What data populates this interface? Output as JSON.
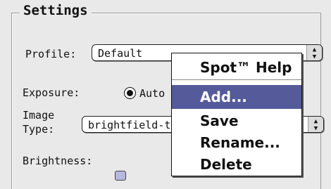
{
  "settings": {
    "title": "Settings",
    "profile_label": "Profile:",
    "profile_value": "Default",
    "exposure_label": "Exposure:",
    "exposure_option": "Auto",
    "image_type_label_line1": "Image",
    "image_type_label_line2": "Type:",
    "image_type_value": "brightfield-tr",
    "brightness_label": "Brightness:"
  },
  "menu": {
    "title_item": "Spot™ Help",
    "items": [
      "Add...",
      "Save",
      "Rename...",
      "Delete"
    ],
    "selected": "Add..."
  }
}
